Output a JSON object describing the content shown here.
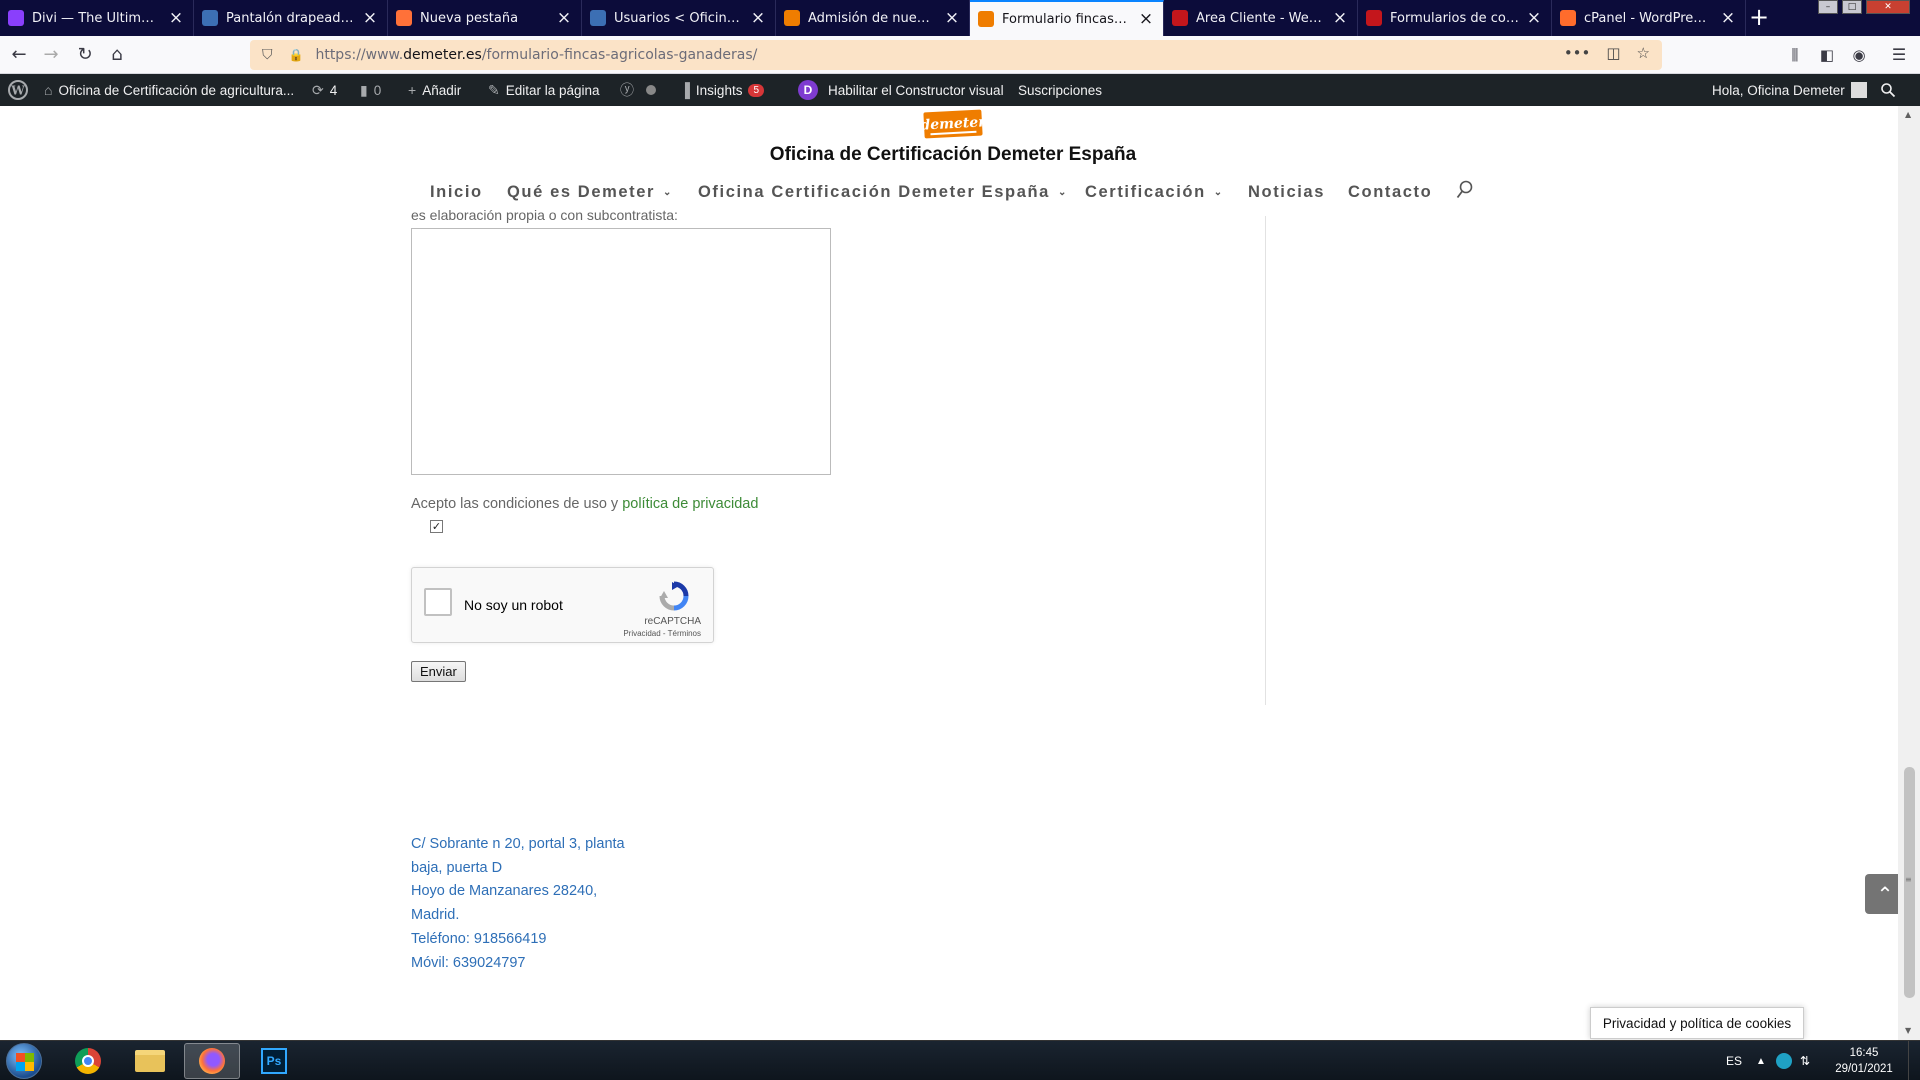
{
  "browser": {
    "tabs": [
      {
        "title": "Divi — The Ultimate Wor",
        "fav_color": "#8a3ffc",
        "active": false
      },
      {
        "title": "Pantalón drapeado en ca",
        "fav_color": "#3c6fb4",
        "active": false
      },
      {
        "title": "Nueva pestaña",
        "fav_color": "#ff7139",
        "active": false
      },
      {
        "title": "Usuarios < Oficina de Ce",
        "fav_color": "#3c6fb4",
        "active": false
      },
      {
        "title": "Admisión de nuevos Ope",
        "fav_color": "#ef7d00",
        "active": false
      },
      {
        "title": "Formulario fincas agricol",
        "fav_color": "#ef7d00",
        "active": true
      },
      {
        "title": "Área Cliente - Webempr",
        "fav_color": "#c4161c",
        "active": false
      },
      {
        "title": "Formularios de contacto",
        "fav_color": "#c4161c",
        "active": false
      },
      {
        "title": "cPanel - WordPress Cent",
        "fav_color": "#ff6c2c",
        "active": false
      }
    ],
    "url_prefix": "https://www.",
    "url_domain": "demeter.es",
    "url_path": "/formulario-fincas-agricolas-ganaderas/"
  },
  "admin_bar": {
    "site_name": "Oficina de Certificación de agricultura...",
    "updates_count": "4",
    "comments_count": "0",
    "add_label": "Añadir",
    "edit_label": "Editar la página",
    "insights_label": "Insights",
    "insights_badge": "5",
    "divi_letter": "D",
    "builder_label": "Habilitar el Constructor visual",
    "subscriptions_label": "Suscripciones",
    "greeting": "Hola, Oficina Demeter"
  },
  "site": {
    "logo_text": "demeter",
    "title": "Oficina de Certificación Demeter España",
    "nav": [
      {
        "label": "Inicio",
        "has_submenu": false
      },
      {
        "label": "Qué es Demeter",
        "has_submenu": true
      },
      {
        "label": "Oficina Certificación Demeter España",
        "has_submenu": true
      },
      {
        "label": "Certificación",
        "has_submenu": true
      },
      {
        "label": "Noticias",
        "has_submenu": false
      },
      {
        "label": "Contacto",
        "has_submenu": false
      }
    ]
  },
  "form": {
    "clipped_label": "es elaboración propia o con subcontratista:",
    "textarea_value": "",
    "accept_text": "Acepto las condiciones de uso y ",
    "privacy_link": "política de privacidad",
    "accept_checked": true,
    "recaptcha_label": "No soy un robot",
    "recaptcha_brand": "reCAPTCHA",
    "recaptcha_privacy": "Privacidad",
    "recaptcha_sep": " - ",
    "recaptcha_terms": "Términos",
    "submit_label": "Enviar"
  },
  "footer": {
    "address_lines": [
      "C/ Sobrante n 20, portal 3, planta",
      "baja, puerta D",
      "Hoyo de Manzanares 28240,",
      "Madrid.",
      "Teléfono: 918566419",
      "Móvil: 639024797"
    ]
  },
  "cookie_notice": "Privacidad y política de cookies",
  "taskbar": {
    "language": "ES",
    "time": "16:45",
    "date": "29/01/2021",
    "ps_label": "Ps"
  },
  "colors": {
    "link_green": "#3d8b37",
    "address_blue": "#2e6fb7",
    "admin_bar": "#1d2327",
    "logo_orange": "#ef7d00",
    "url_bar": "#fbe3c7"
  }
}
